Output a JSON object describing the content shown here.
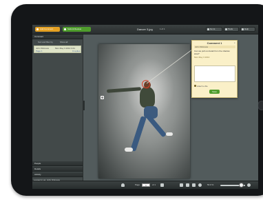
{
  "topbar": {
    "add_comment_label": "Add Comment",
    "submit_review_label": "Submit Review",
    "document_title": "Dancer 3.jpg",
    "pager": "1 of 1",
    "goto_label": "Go to",
    "tools_label": "Tools",
    "help_label": "Help"
  },
  "sidebar": {
    "comments_header": "Comment",
    "sort_label": "Sort and filter by",
    "show_label": "Show all",
    "comment_item": {
      "author": "John Shimano",
      "date": "Mon May 3 2010 3:41",
      "page": "Page 1",
      "status": "0 replies"
    },
    "people_header": "People",
    "details_header": "Details",
    "activity_header": "Activity",
    "login_text": "Logged in as: John Shimano"
  },
  "popup": {
    "title": "Comment 1",
    "close": "x",
    "author": "John Shimano",
    "text": "Can we pull out detail from the shadow area?",
    "date": "Mon May 3 2010",
    "attach_label": "Attach a file",
    "save_label": "Save"
  },
  "bottombar": {
    "page_label": "Page",
    "page_value": "1",
    "of_label": "of 1",
    "zoom_label": "50.0 %"
  },
  "icons": {
    "add_comment": "comment-plus-icon",
    "submit_review": "check-icon",
    "goto": "goto-icon",
    "tools": "gear-icon",
    "help": "help-icon",
    "hand": "hand-icon",
    "rotate": "rotate-icon",
    "zoom_in": "zoom-in-icon",
    "move": "move-icon"
  },
  "colors": {
    "accent_orange": "#e5a123",
    "accent_green": "#4f9d2c",
    "popup_bg": "#faf0c8",
    "marker": "#d6432b"
  }
}
